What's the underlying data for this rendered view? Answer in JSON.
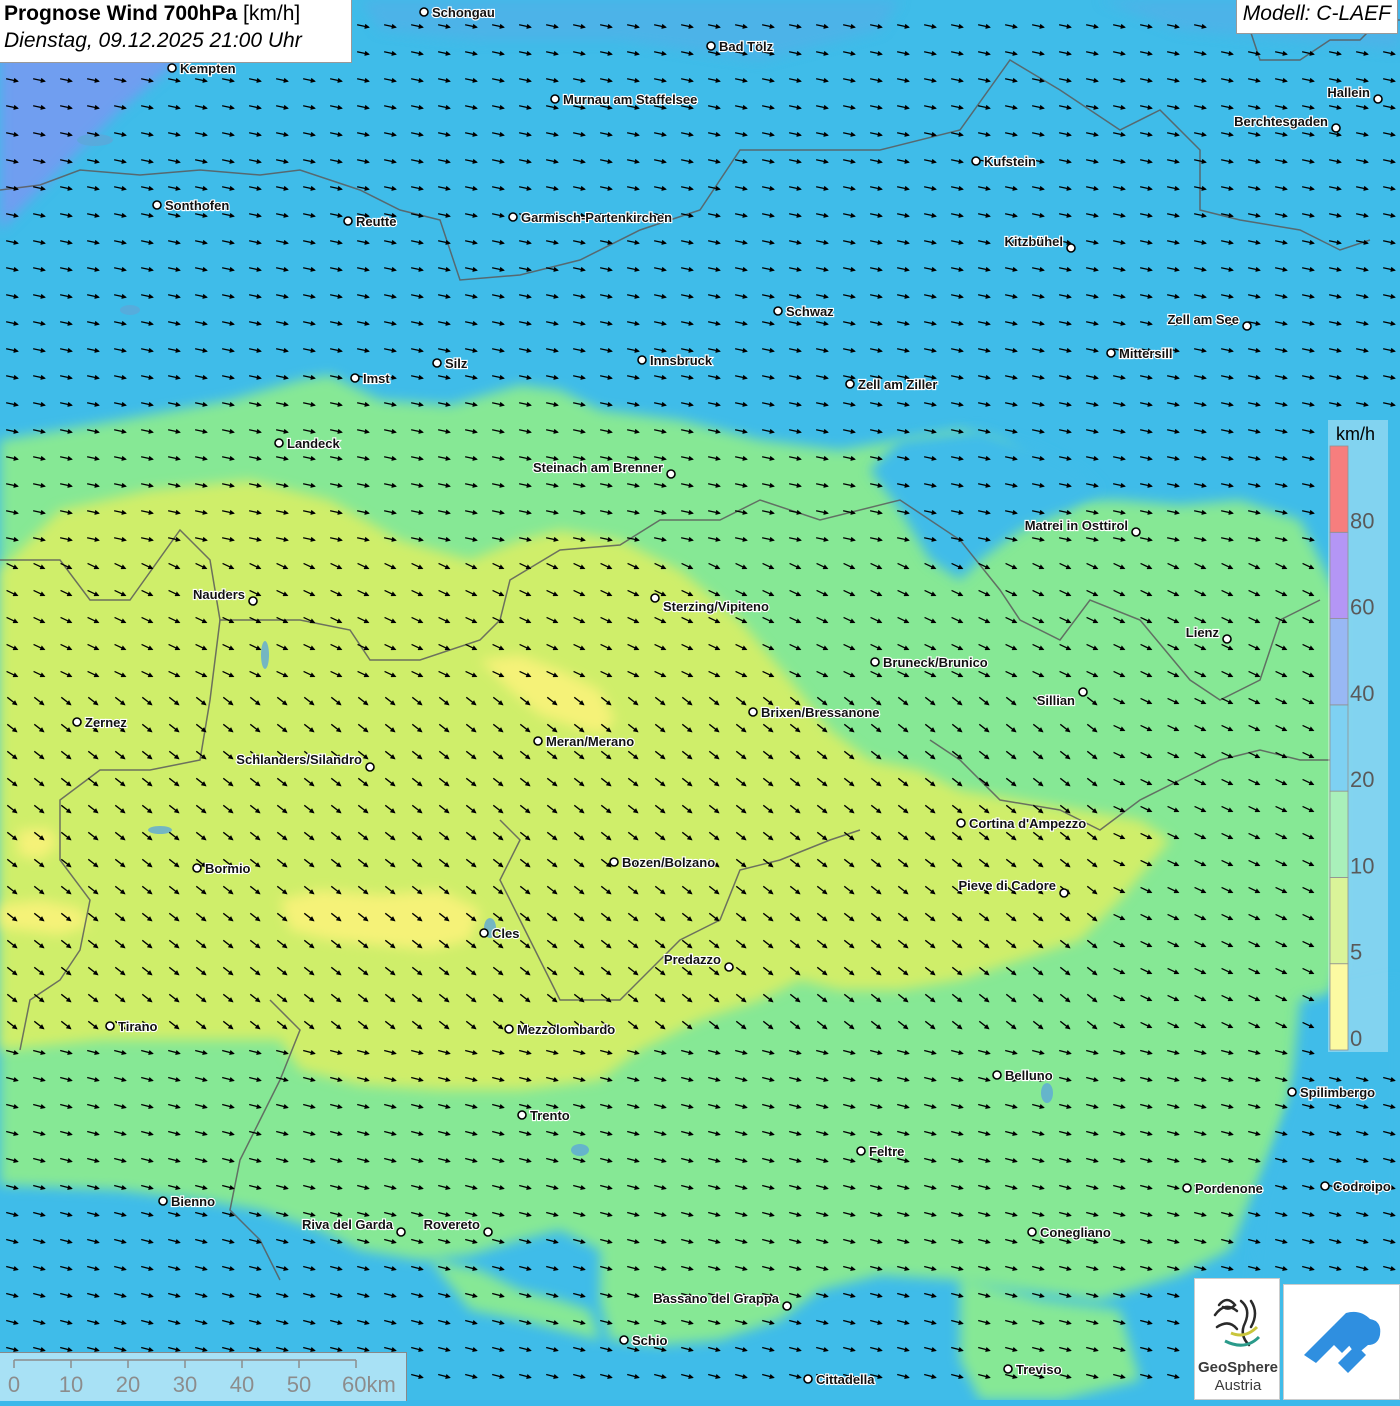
{
  "header": {
    "title_bold": "Prognose Wind 700hPa",
    "title_unit": "[km/h]",
    "datetime": "Dienstag, 09.12.2025 21:00 Uhr",
    "model": "Modell: C-LAEF"
  },
  "legend": {
    "unit": "km/h",
    "ticks": [
      "0",
      "5",
      "10",
      "20",
      "40",
      "60",
      "80"
    ],
    "bands": [
      {
        "from": "0",
        "to": "5",
        "color": "#fbf871"
      },
      {
        "from": "5",
        "to": "10",
        "color": "#c6ee63"
      },
      {
        "from": "10",
        "to": "20",
        "color": "#7be895"
      },
      {
        "from": "20",
        "to": "40",
        "color": "#3ab9eb"
      },
      {
        "from": "40",
        "to": "60",
        "color": "#6192ee"
      },
      {
        "from": "60",
        "to": "80",
        "color": "#8d5ff0"
      },
      {
        "from": "80",
        "to": "",
        "color": "#f23a3a"
      }
    ]
  },
  "colors": {
    "wind_0_5": "#f5f278",
    "wind_5_10": "#cfee6b",
    "wind_10_20": "#86e895",
    "wind_20_40": "#3fbce9",
    "wind_40_60": "#6f9ef0",
    "border": "#555555",
    "arrow": "#000000"
  },
  "scale_bar": {
    "labels": [
      "0",
      "10",
      "20",
      "30",
      "40",
      "50",
      "60km"
    ]
  },
  "cities": [
    {
      "name": "Schongau"
    },
    {
      "name": "Bad Tölz"
    },
    {
      "name": "Kempten"
    },
    {
      "name": "Murnau am Staffelsee"
    },
    {
      "name": "Hallein"
    },
    {
      "name": "Berchtesgaden"
    },
    {
      "name": "Kufstein"
    },
    {
      "name": "Sonthofen"
    },
    {
      "name": "Reutte"
    },
    {
      "name": "Garmisch-Partenkirchen"
    },
    {
      "name": "Kitzbühel"
    },
    {
      "name": "Schwaz"
    },
    {
      "name": "Zell am See"
    },
    {
      "name": "Mittersill"
    },
    {
      "name": "Innsbruck"
    },
    {
      "name": "Silz"
    },
    {
      "name": "Imst"
    },
    {
      "name": "Zell am Ziller"
    },
    {
      "name": "Landeck"
    },
    {
      "name": "Steinach am Brenner"
    },
    {
      "name": "Matrei in Osttirol"
    },
    {
      "name": "Nauders"
    },
    {
      "name": "Sterzing/Vipiteno"
    },
    {
      "name": "Lienz"
    },
    {
      "name": "Bruneck/Brunico"
    },
    {
      "name": "Sillian"
    },
    {
      "name": "Brixen/Bressanone"
    },
    {
      "name": "Zernez"
    },
    {
      "name": "Meran/Merano"
    },
    {
      "name": "Schlanders/Silandro"
    },
    {
      "name": "Cortina d'Ampezzo"
    },
    {
      "name": "Bozen/Bolzano"
    },
    {
      "name": "Bormio"
    },
    {
      "name": "Pieve di Cadore"
    },
    {
      "name": "Cles"
    },
    {
      "name": "Predazzo"
    },
    {
      "name": "Tirano"
    },
    {
      "name": "Mezzolombardo"
    },
    {
      "name": "Belluno"
    },
    {
      "name": "Spilimbergo"
    },
    {
      "name": "Trento"
    },
    {
      "name": "Feltre"
    },
    {
      "name": "Pordenone"
    },
    {
      "name": "Codroipo"
    },
    {
      "name": "Bienno"
    },
    {
      "name": "Riva del Garda"
    },
    {
      "name": "Rovereto"
    },
    {
      "name": "Conegliano"
    },
    {
      "name": "Bassano del Grappa"
    },
    {
      "name": "Schio"
    },
    {
      "name": "Treviso"
    },
    {
      "name": "Cittadella"
    }
  ],
  "logos": {
    "geosphere_line1": "GeoSphere",
    "geosphere_line2": "Austria"
  }
}
